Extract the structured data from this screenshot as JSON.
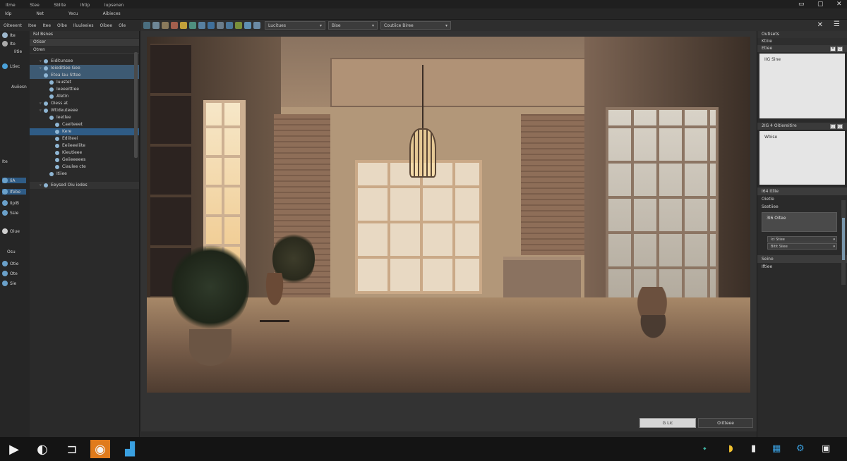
{
  "titlebar": {
    "menu": [
      "Itme",
      "Stee",
      "Sblite",
      "Ihtip",
      "Iupsenen"
    ]
  },
  "menubar2": [
    "Idp",
    "Net",
    "Yecu",
    "Aibieces"
  ],
  "menubar3": [
    "Oiteeent",
    "Itee",
    "Itee",
    "Olbe",
    "Iluuleeies",
    "Oibee",
    "Ole"
  ],
  "toolbar": {
    "dropdowns": [
      {
        "label": "Lucitues"
      },
      {
        "label": "Bise"
      },
      {
        "label": "Coutiice Biree"
      }
    ]
  },
  "left_rail": {
    "items": [
      "Ite",
      "Ite",
      "Iitie",
      "Ltiec",
      "Auiiesn",
      "Ite",
      "IiA",
      "Ifebe",
      "IipiB",
      "Ssie",
      "Oiue",
      "Osu",
      "Otie",
      "Ote",
      "Sie"
    ]
  },
  "left_panel": {
    "header": "Fal Bsnes",
    "sub1": "Otiser",
    "sub2": "Otren",
    "tree": [
      {
        "label": "Eiditunsee",
        "indent": 1,
        "state": "none",
        "tri": true
      },
      {
        "label": "Ieieditiee Gee",
        "indent": 1,
        "state": "sel",
        "tri": true
      },
      {
        "label": "Etea Iau Sttee",
        "indent": 1,
        "state": "sel",
        "tri": false
      },
      {
        "label": "Iuustet",
        "indent": 2,
        "state": "none",
        "tri": false
      },
      {
        "label": "Ieeeeittiee",
        "indent": 2,
        "state": "none",
        "tri": false
      },
      {
        "label": "Aletin",
        "indent": 2,
        "state": "none",
        "tri": false
      },
      {
        "label": "Oiess at",
        "indent": 1,
        "state": "none",
        "tri": true
      },
      {
        "label": "Wtideuteeee",
        "indent": 1,
        "state": "none",
        "tri": true
      },
      {
        "label": "Ieetlee",
        "indent": 2,
        "state": "none",
        "tri": false
      },
      {
        "label": "Caeiteeet",
        "indent": 3,
        "state": "none",
        "tri": false
      },
      {
        "label": "Kere",
        "indent": 3,
        "state": "selblue",
        "tri": false
      },
      {
        "label": "Ediiteei",
        "indent": 3,
        "state": "none",
        "tri": false
      },
      {
        "label": "Eeiieeeliite",
        "indent": 3,
        "state": "none",
        "tri": false
      },
      {
        "label": "Kieutieee",
        "indent": 3,
        "state": "none",
        "tri": false
      },
      {
        "label": "Geiieeeees",
        "indent": 3,
        "state": "none",
        "tri": false
      },
      {
        "label": "Ciaulee cte",
        "indent": 3,
        "state": "none",
        "tri": false
      },
      {
        "label": "Itiiee",
        "indent": 2,
        "state": "none",
        "tri": false
      },
      {
        "label": "Eeysed Oiu iedes",
        "indent": 1,
        "state": "footer",
        "tri": true
      }
    ]
  },
  "right_panel": {
    "head": "Outisets",
    "sub_a": "Ktiiie",
    "sub_b": "Etiee",
    "box1": "IIG Sine",
    "sub_c": "2IG 4 Oitiereitire",
    "box2": "Wbise",
    "row_a": "I64 Itliie",
    "row_b": "Oietle",
    "row_c": "Ssetiiee",
    "field": "3I6 Oitee",
    "select1": "Ici Stiee",
    "select2": "Bitit Siiee",
    "row_d": "Seine",
    "row_e": "Iftiee"
  },
  "buttons": {
    "ok": "G Lic",
    "cancel": "Oiitteee"
  }
}
